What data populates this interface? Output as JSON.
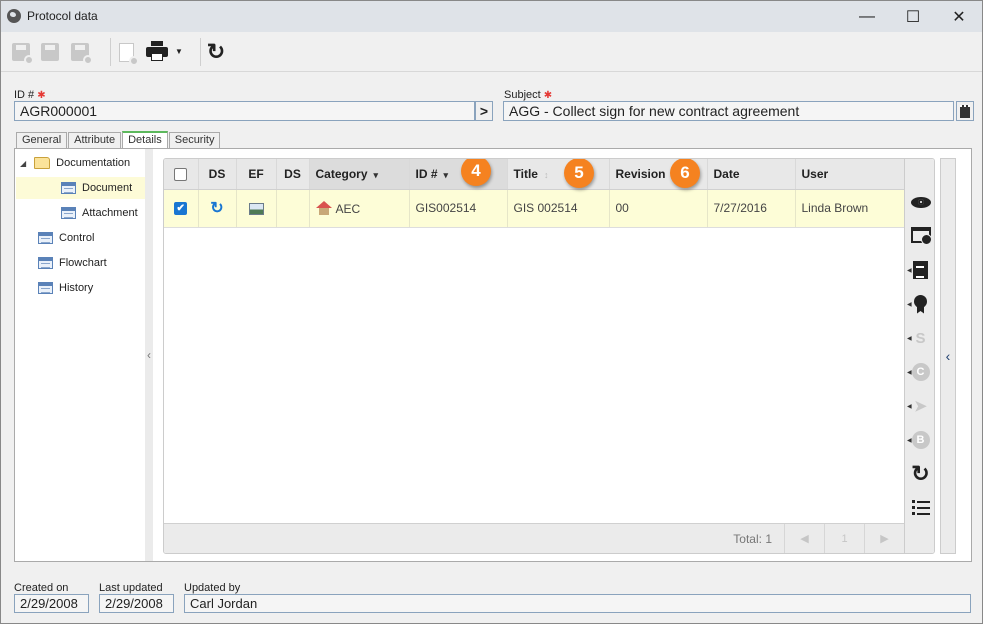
{
  "window": {
    "title": "Protocol data",
    "controls": {
      "minimize": "—",
      "maximize": "☐",
      "close": "✕"
    }
  },
  "toolbar": {
    "buttons": [
      {
        "name": "save-and-new",
        "icon": "floppy-plus-icon",
        "enabled": false
      },
      {
        "name": "save",
        "icon": "floppy-icon",
        "enabled": false
      },
      {
        "name": "save-and-close",
        "icon": "floppy-x-icon",
        "enabled": false
      },
      {
        "name": "new-from-document",
        "icon": "document-plus-icon",
        "enabled": false
      },
      {
        "name": "print",
        "icon": "printer-icon",
        "enabled": true,
        "has_dropdown": true
      },
      {
        "name": "refresh",
        "icon": "refresh-icon",
        "enabled": true
      }
    ],
    "refresh_glyph": "↻",
    "dropdown_glyph": "▼"
  },
  "form": {
    "id_label": "ID #",
    "id_value": "AGR000001",
    "id_button_glyph": ">",
    "subject_label": "Subject",
    "subject_value": "AGG - Collect sign for new contract agreement",
    "required_glyph": "✱"
  },
  "tabs": [
    {
      "label": "General",
      "active": false
    },
    {
      "label": "Attribute",
      "active": false
    },
    {
      "label": "Details",
      "active": true
    },
    {
      "label": "Security",
      "active": false
    }
  ],
  "tree": {
    "expander_glyph": "◢",
    "items": [
      {
        "label": "Documentation",
        "icon": "folder-icon",
        "level": 0,
        "expanded": true
      },
      {
        "label": "Document",
        "icon": "grid-icon",
        "level": 1,
        "selected": true
      },
      {
        "label": "Attachment",
        "icon": "grid-icon",
        "level": 1
      },
      {
        "label": "Control",
        "icon": "grid-icon",
        "level": 0
      },
      {
        "label": "Flowchart",
        "icon": "grid-icon",
        "level": 0
      },
      {
        "label": "History",
        "icon": "grid-icon",
        "level": 0
      }
    ],
    "splitter_glyph": "‹"
  },
  "grid": {
    "columns": [
      {
        "label": "",
        "key": "select"
      },
      {
        "label": "DS",
        "key": "ds1"
      },
      {
        "label": "EF",
        "key": "ef"
      },
      {
        "label": "DS",
        "key": "ds2"
      },
      {
        "label": "Category",
        "key": "category",
        "sort": "desc"
      },
      {
        "label": "ID #",
        "key": "id",
        "sort": "desc"
      },
      {
        "label": "Title",
        "key": "title",
        "sort": "none"
      },
      {
        "label": "Revision",
        "key": "revision"
      },
      {
        "label": "Date",
        "key": "date"
      },
      {
        "label": "User",
        "key": "user"
      }
    ],
    "sort_glyph": "▾",
    "sort_none_glyph": "↕",
    "rows": [
      {
        "selected": true,
        "ds1_icon": "sync-icon",
        "ef_icon": "image-icon",
        "ds2": "",
        "category_icon": "house-icon",
        "category": "AEC",
        "id": "GIS002514",
        "title": "GIS 002514",
        "revision": "00",
        "date": "7/27/2016",
        "user": "Linda Brown"
      }
    ],
    "checkmark": "✔",
    "sync_glyph": "↻",
    "callouts": [
      "4",
      "5",
      "6"
    ],
    "footer": {
      "total_label": "Total: 1",
      "prev_glyph": "◀",
      "page": "1",
      "next_glyph": "▶"
    }
  },
  "side_actions": [
    {
      "name": "view",
      "icon": "eye-icon",
      "enabled": true
    },
    {
      "name": "view-window",
      "icon": "window-view-icon",
      "enabled": true
    },
    {
      "name": "edit-notes",
      "icon": "notepad-edit-icon",
      "enabled": true,
      "has_menu": true
    },
    {
      "name": "certify",
      "icon": "award-icon",
      "enabled": true,
      "has_menu": true
    },
    {
      "name": "digital-signature",
      "icon": "signature-icon",
      "enabled": false,
      "has_menu": true,
      "glyph": "S"
    },
    {
      "name": "checkout",
      "icon": "checkout-icon",
      "enabled": false,
      "has_menu": true,
      "glyph": "C"
    },
    {
      "name": "send",
      "icon": "send-icon",
      "enabled": false,
      "has_menu": true,
      "glyph": "➤"
    },
    {
      "name": "block",
      "icon": "b-circle-icon",
      "enabled": false,
      "has_menu": true,
      "glyph": "B"
    },
    {
      "name": "refresh",
      "icon": "refresh-icon",
      "enabled": true,
      "glyph": "↻"
    },
    {
      "name": "list-view",
      "icon": "list-icon",
      "enabled": true
    }
  ],
  "side_collapse_glyph": "‹",
  "menu_tri_glyph": "◀",
  "footer": {
    "created_on_label": "Created on",
    "created_on_value": "2/29/2008",
    "last_updated_label": "Last updated",
    "last_updated_value": "2/29/2008",
    "updated_by_label": "Updated by",
    "updated_by_value": "Carl Jordan"
  }
}
